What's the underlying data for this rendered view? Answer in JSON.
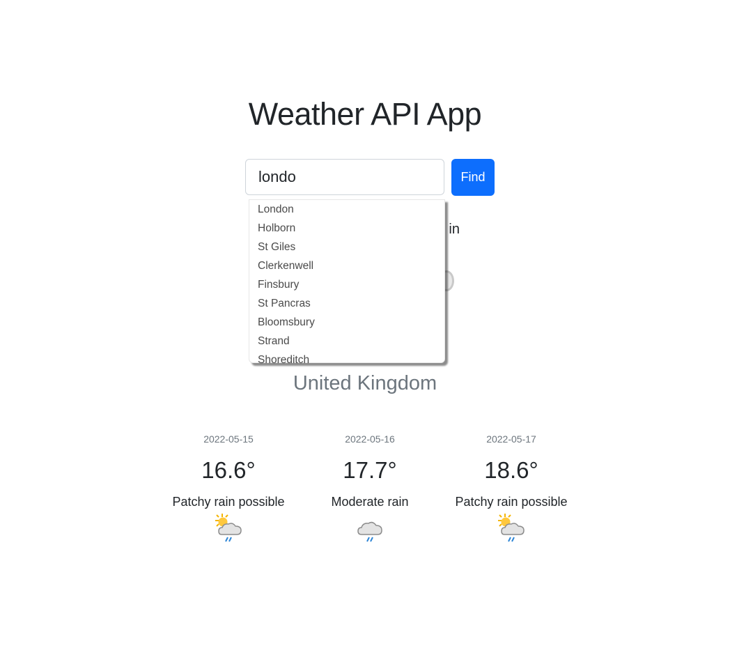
{
  "app": {
    "title": "Weather API App"
  },
  "search": {
    "value": "londo",
    "button_label": "Find"
  },
  "dropdown": {
    "options": [
      "London",
      "Holborn",
      "St Giles",
      "Clerkenwell",
      "Finsbury",
      "St Pancras",
      "Bloomsbury",
      "Strand",
      "Shoreditch"
    ]
  },
  "current": {
    "condition_visible": "in",
    "country": "United Kingdom"
  },
  "forecast": [
    {
      "date": "2022-05-15",
      "temp": "16.6°",
      "condition": "Patchy rain possible",
      "icon": "sun-cloud-rain-icon"
    },
    {
      "date": "2022-05-16",
      "temp": "17.7°",
      "condition": "Moderate rain",
      "icon": "cloud-rain-icon"
    },
    {
      "date": "2022-05-17",
      "temp": "18.6°",
      "condition": "Patchy rain possible",
      "icon": "sun-cloud-rain-icon"
    }
  ],
  "colors": {
    "accent": "#0d6efd",
    "muted": "#6c757d",
    "text": "#212529"
  }
}
